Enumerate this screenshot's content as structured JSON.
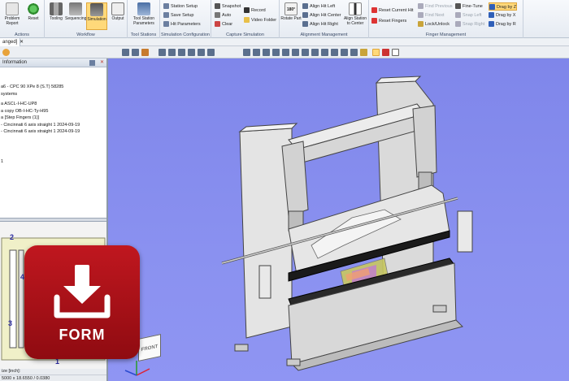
{
  "ribbon": {
    "problem_report": "Problem Report",
    "reset": "Reset",
    "actions_group": "Actions",
    "tooling": "Tooling",
    "sequencing": "Sequencing",
    "simulation": "Simulation",
    "output": "Output",
    "workflow_group": "Workflow",
    "tool_station_parameters": "Tool Station Parameters",
    "tool_stations_group": "Tool Stations",
    "station_setup": "Station Setup",
    "save_setup": "Save Setup",
    "hit_parameters": "Hit Parameters",
    "simulation_configuration_group": "Simulation Configuration",
    "snapshot": "Snapshot",
    "auto": "Auto",
    "clear": "Clear",
    "record": "Record",
    "video_folder": "Video Folder",
    "capture_simulation_group": "Capture Simulation",
    "rotate_part": "Rotate Part",
    "rotate_value": "180°",
    "align_hit_left": "Align Hit Left",
    "align_hit_center": "Align Hit Center",
    "align_hit_right": "Align Hit Right",
    "align_station_to_center": "Align Station to Center",
    "alignment_management_group": "Alignment Management",
    "reset_current_hit": "Reset Current Hit",
    "reset_fingers": "Reset Fingers",
    "find_previous": "Find Previous",
    "find_next": "Find Next",
    "lock_unlock": "Lock/Unlock",
    "fine_tune": "Fine-Tune",
    "snap_left": "Snap Left",
    "snap_right": "Snap Right",
    "drag_by_z": "Drag by Z",
    "drag_by_x": "Drag by X",
    "drag_by_r": "Drag by R",
    "finger_management_group": "Finger Management"
  },
  "toolbar2": {
    "tab_label": "anged]",
    "close": "✕"
  },
  "left_panel": {
    "title": "Information",
    "lines": [
      "a6 - CPC 90 XPe 8 (S.T) 58285",
      "systems",
      "a ASCL-I-HC-UP8",
      "a copy OB-I-HC-Ty-H95",
      "a [Step Fingers (1)]",
      "- Cincinnati 6 axis straight 1 2024-09-19",
      "- Cincinnati 6 axis straight 1 2024-09-19"
    ],
    "extra_line": "1",
    "station_labels": [
      "2",
      "4",
      "3",
      "1"
    ],
    "status_size": "ize [inch]:",
    "status_dims": "5000 x 18.6550 / 0.0380"
  },
  "badge": {
    "label": "FORM"
  },
  "viewcube": {
    "face": "FRONT"
  },
  "colors": {
    "viewport_bg": "#8a91f0",
    "badge_red": "#b3141b",
    "ribbon_active": "#ffd97a"
  }
}
